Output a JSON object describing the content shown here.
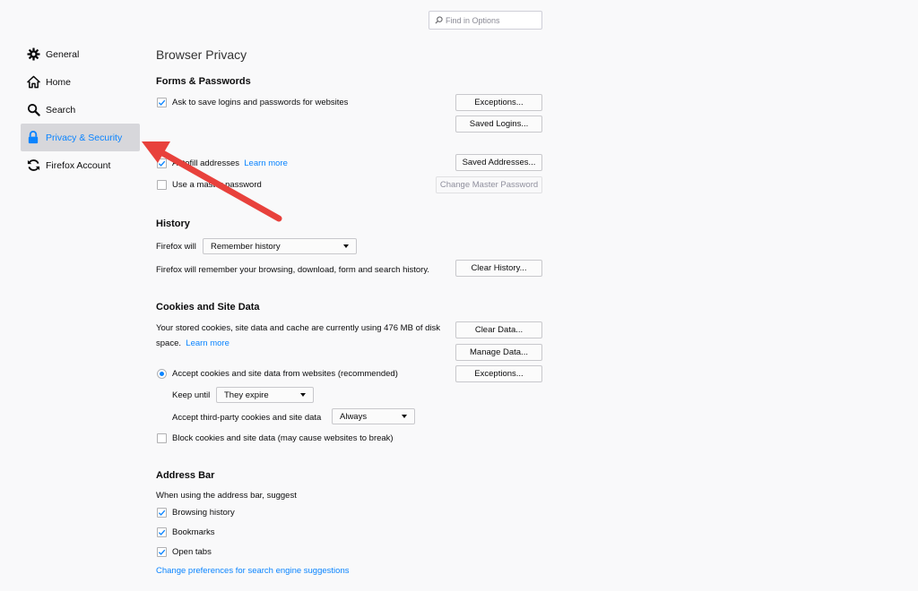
{
  "search": {
    "placeholder": "Find in Options"
  },
  "sidebar": {
    "items": [
      {
        "label": "General",
        "icon": "gear-icon"
      },
      {
        "label": "Home",
        "icon": "home-icon"
      },
      {
        "label": "Search",
        "icon": "magnifier-icon"
      },
      {
        "label": "Privacy & Security",
        "icon": "lock-icon",
        "selected": true
      },
      {
        "label": "Firefox Account",
        "icon": "sync-icon"
      }
    ]
  },
  "page": {
    "title": "Browser Privacy"
  },
  "forms": {
    "title": "Forms & Passwords",
    "ask_save_label": "Ask to save logins and passwords for websites",
    "exceptions_button": "Exceptions...",
    "saved_logins_button": "Saved Logins...",
    "autofill_label": "Autofill addresses",
    "learn_more": "Learn more",
    "saved_addresses_button": "Saved Addresses...",
    "master_password_label": "Use a master password",
    "change_master_button": "Change Master Password"
  },
  "history": {
    "title": "History",
    "firefox_will_label": "Firefox will",
    "mode_value": "Remember history",
    "description": "Firefox will remember your browsing, download, form and search history.",
    "clear_history_button": "Clear History..."
  },
  "cookies": {
    "title": "Cookies and Site Data",
    "desc_line1": "Your stored cookies, site data and cache are currently using 476 MB of disk",
    "desc_line2": "space.",
    "learn_more": "Learn more",
    "clear_data_button": "Clear Data...",
    "manage_data_button": "Manage Data...",
    "exceptions_button": "Exceptions...",
    "accept_label": "Accept cookies and site data from websites (recommended)",
    "keep_until_label": "Keep until",
    "keep_until_value": "They expire",
    "third_party_label": "Accept third-party cookies and site data",
    "third_party_value": "Always",
    "block_label": "Block cookies and site data (may cause websites to break)"
  },
  "address_bar": {
    "title": "Address Bar",
    "intro": "When using the address bar, suggest",
    "options": [
      "Browsing history",
      "Bookmarks",
      "Open tabs"
    ],
    "change_prefs_link": "Change preferences for search engine suggestions"
  },
  "colors": {
    "accent": "#0a84ff",
    "annotation_arrow": "#e8413c"
  }
}
